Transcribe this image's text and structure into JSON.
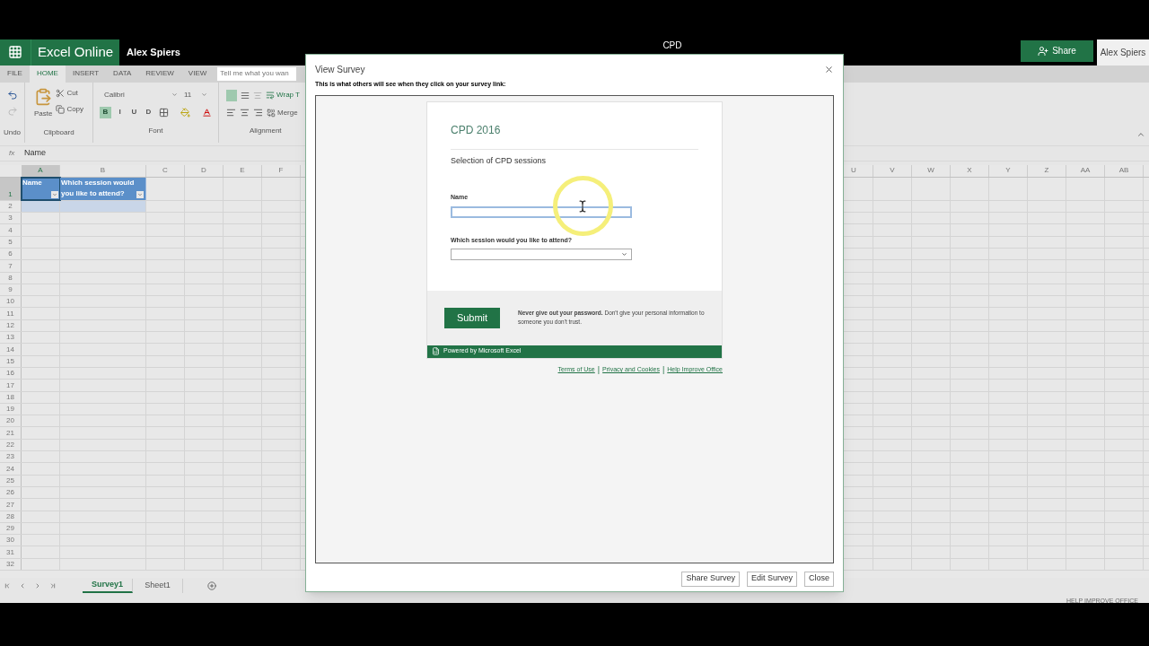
{
  "app_bar": {
    "name": "Excel Online",
    "user": "Alex Spiers",
    "doc_title": "CPD",
    "share": "Share",
    "account": "Alex Spiers"
  },
  "ribbon_tabs": [
    {
      "label": "FILE",
      "selected": false
    },
    {
      "label": "HOME",
      "selected": true
    },
    {
      "label": "INSERT",
      "selected": false
    },
    {
      "label": "DATA",
      "selected": false
    },
    {
      "label": "REVIEW",
      "selected": false
    },
    {
      "label": "VIEW",
      "selected": false
    }
  ],
  "tell_me": {
    "placeholder": "Tell me what you wan"
  },
  "ribbon": {
    "undo": {
      "label": "Undo"
    },
    "clipboard": {
      "paste": "Paste",
      "cut": "Cut",
      "copy": "Copy",
      "label": "Clipboard"
    },
    "font": {
      "name": "Calibri",
      "size": "11",
      "styles": [
        {
          "label": "B",
          "selected": true
        },
        {
          "label": "I",
          "selected": false
        },
        {
          "label": "U",
          "selected": false
        },
        {
          "label": "D",
          "selected": false
        }
      ],
      "label": "Font"
    },
    "alignment": {
      "wrap": "Wrap T",
      "merge": "Merge",
      "label": "Alignment"
    }
  },
  "formula_bar": {
    "fx_label": "fx",
    "value": "Name"
  },
  "grid": {
    "columns_left": [
      {
        "label": "A",
        "selected": true
      },
      {
        "label": "B",
        "selected": false
      },
      {
        "label": "C",
        "selected": false
      },
      {
        "label": "D",
        "selected": false
      },
      {
        "label": "E",
        "selected": false
      },
      {
        "label": "F",
        "selected": false
      }
    ],
    "columns_right": [
      {
        "label": "U",
        "selected": false
      },
      {
        "label": "V",
        "selected": false
      },
      {
        "label": "W",
        "selected": false
      },
      {
        "label": "X",
        "selected": false
      },
      {
        "label": "Y",
        "selected": false
      },
      {
        "label": "Z",
        "selected": false
      },
      {
        "label": "AA",
        "selected": false
      },
      {
        "label": "AB",
        "selected": false
      }
    ],
    "table_headers": [
      {
        "text": "Name",
        "selected": true
      },
      {
        "text": "Which session would you like to attend?",
        "selected": false
      }
    ],
    "rows": [
      {
        "label": "1",
        "selected": true
      },
      {
        "label": "2",
        "selected": false
      },
      {
        "label": "3",
        "selected": false
      },
      {
        "label": "4",
        "selected": false
      },
      {
        "label": "5",
        "selected": false
      },
      {
        "label": "6",
        "selected": false
      },
      {
        "label": "7",
        "selected": false
      },
      {
        "label": "8",
        "selected": false
      },
      {
        "label": "9",
        "selected": false
      },
      {
        "label": "10",
        "selected": false
      },
      {
        "label": "11",
        "selected": false
      },
      {
        "label": "12",
        "selected": false
      },
      {
        "label": "13",
        "selected": false
      },
      {
        "label": "14",
        "selected": false
      },
      {
        "label": "15",
        "selected": false
      },
      {
        "label": "16",
        "selected": false
      },
      {
        "label": "17",
        "selected": false
      },
      {
        "label": "18",
        "selected": false
      },
      {
        "label": "19",
        "selected": false
      },
      {
        "label": "20",
        "selected": false
      },
      {
        "label": "21",
        "selected": false
      },
      {
        "label": "22",
        "selected": false
      },
      {
        "label": "23",
        "selected": false
      },
      {
        "label": "24",
        "selected": false
      },
      {
        "label": "25",
        "selected": false
      },
      {
        "label": "26",
        "selected": false
      },
      {
        "label": "27",
        "selected": false
      },
      {
        "label": "28",
        "selected": false
      },
      {
        "label": "29",
        "selected": false
      },
      {
        "label": "30",
        "selected": false
      },
      {
        "label": "31",
        "selected": false
      },
      {
        "label": "32",
        "selected": false
      }
    ]
  },
  "sheet_tabs": [
    {
      "label": "Survey1",
      "selected": true
    },
    {
      "label": "Sheet1",
      "selected": false
    }
  ],
  "status_bar": {
    "text": "HELP IMPROVE OFFICE"
  },
  "dialog": {
    "title": "View Survey",
    "subtitle": "This is what others will see when they click on your survey link:",
    "survey": {
      "title": "CPD 2016",
      "description": "Selection of CPD sessions",
      "questions": [
        {
          "kind": "text",
          "label": "Name",
          "focused": true
        },
        {
          "kind": "choice",
          "label": "Which session would you like to attend?",
          "focused": false
        }
      ],
      "submit": "Submit",
      "notice": "**Never give out your password.** Don't give your personal information to someone you don't trust.",
      "powered_by": "Powered by Microsoft Excel",
      "links": [
        {
          "kind": "link",
          "text": "Terms of Use"
        },
        {
          "kind": "separator",
          "text": "|"
        },
        {
          "kind": "link",
          "text": "Privacy and Cookies"
        },
        {
          "kind": "separator",
          "text": "|"
        },
        {
          "kind": "link",
          "text": "Help Improve Office"
        }
      ]
    },
    "buttons": [
      "Share Survey",
      "Edit Survey",
      "Close"
    ]
  }
}
